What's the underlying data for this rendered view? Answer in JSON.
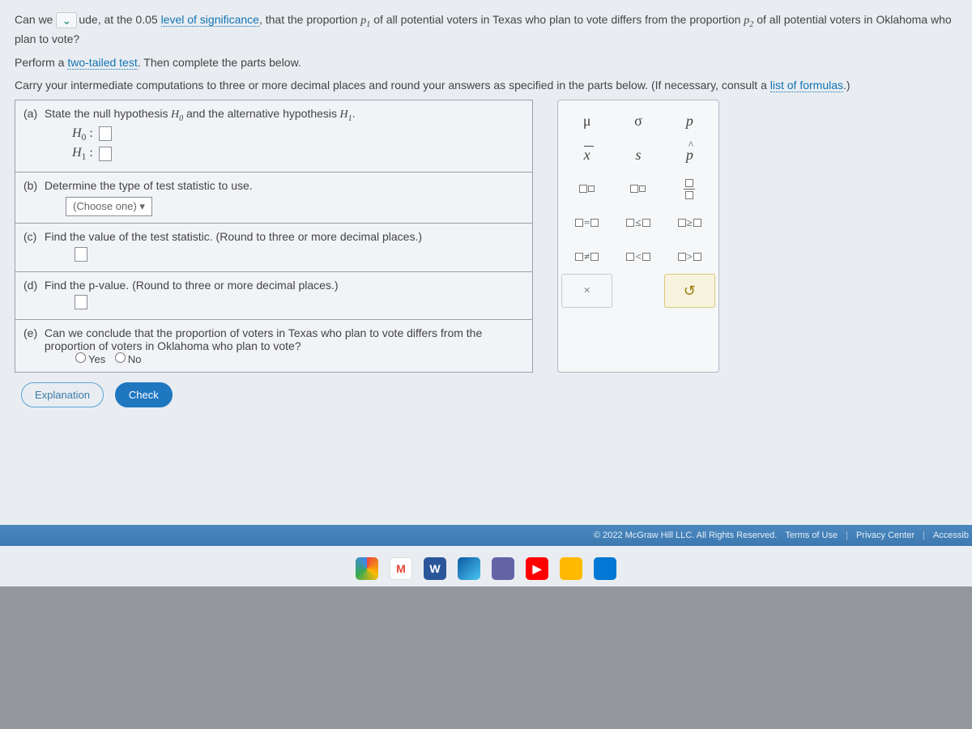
{
  "intro": {
    "question_pre": "Can we ",
    "question_mid": "ude, at the ",
    "sig_level": "0.05 ",
    "sig_link": "level of significance",
    "question_post1": ", that the proportion ",
    "p1": "p",
    "p1_sub": "1",
    "question_post2": " of all potential voters in Texas who plan to vote differs from the proportion ",
    "p2": "p",
    "p2_sub": "2",
    "question_post3": " of all potential voters in Oklahoma who plan to vote?",
    "perform": "Perform a ",
    "two_tailed": "two-tailed test",
    "perform_post": ". Then complete the parts below.",
    "carry": "Carry your intermediate computations to three or more decimal places and round your answers as specified in the parts below. (If necessary, consult a ",
    "formulas": "list of formulas",
    "carry_post": ".)"
  },
  "parts": {
    "a_label": "(a)",
    "a_text1": "State the ",
    "a_null": "null hypothesis",
    "a_H0": " H",
    "a_H0sub": "0",
    "a_and": " and the ",
    "a_alt": "alternative hypothesis",
    "a_H1": " H",
    "a_H1sub": "1",
    "a_dot": ".",
    "h0_label": "H",
    "h0_sub": "0",
    "h0_colon": " : ",
    "h1_label": "H",
    "h1_sub": "1",
    "h1_colon": " : ",
    "b_label": "(b)",
    "b_text1": "Determine the type of ",
    "b_link": "test statistic",
    "b_text2": " to use.",
    "b_choose": "(Choose one) ▾",
    "c_label": "(c)",
    "c_text": "Find the value of the test statistic. (Round to three or more decimal places.)",
    "d_label": "(d)",
    "d_text1": "Find the ",
    "d_link": "p-value",
    "d_text2": ". (Round to three or more decimal places.)",
    "e_label": "(e)",
    "e_text": "Can we conclude that the proportion of voters in Texas who plan to vote differs from the proportion of voters in Oklahoma who plan to vote?",
    "yes": "Yes",
    "no": "No"
  },
  "buttons": {
    "explain": "Explanation",
    "check": "Check"
  },
  "palette": {
    "mu": "μ",
    "sigma": "σ",
    "p": "p",
    "xbar": "x",
    "s": "s",
    "phat": "p",
    "eq": "=",
    "le": "≤",
    "ge": "≥",
    "ne": "≠",
    "lt": "<",
    "gt": ">",
    "clear": "×",
    "reset": "↺"
  },
  "footer": {
    "copyright": "© 2022 McGraw Hill LLC. All Rights Reserved.",
    "terms": "Terms of Use",
    "privacy": "Privacy Center",
    "access": "Accessib"
  },
  "taskbar": {
    "chrome": "",
    "gmail": "M",
    "word": "W",
    "edge": "",
    "cam": "",
    "yt": "▶",
    "files": "",
    "app": ""
  }
}
